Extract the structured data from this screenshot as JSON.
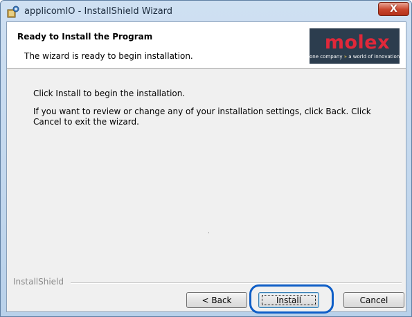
{
  "window": {
    "title": "applicomIO - InstallShield Wizard",
    "close_label": "X"
  },
  "header": {
    "title": "Ready to Install the Program",
    "subtitle": "The wizard is ready to begin installation.",
    "logo_word": "molex",
    "logo_tag_pre": "one company",
    "logo_tag_post": "a world of innovation"
  },
  "body": {
    "line1": "Click Install to begin the installation.",
    "line2": "If you want to review or change any of your installation settings, click Back. Click Cancel to exit the wizard."
  },
  "footer": {
    "frame_label": "InstallShield"
  },
  "buttons": {
    "back": "< Back",
    "install": "Install",
    "cancel": "Cancel"
  },
  "colors": {
    "highlight": "#0e5ec7",
    "logo_red": "#e0283a",
    "logo_bg": "#2c3d4e"
  }
}
